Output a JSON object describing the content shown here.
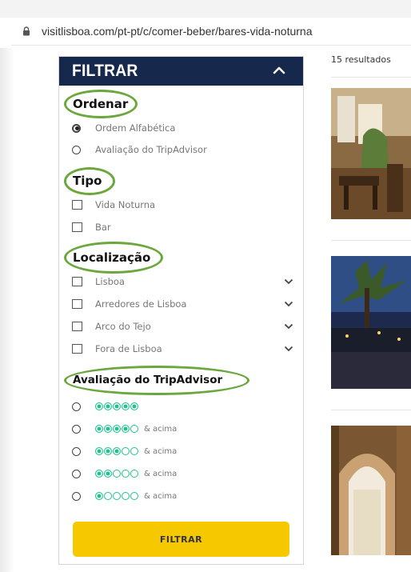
{
  "browser": {
    "url": "visitlisboa.com/pt-pt/c/comer-beber/bares-vida-noturna"
  },
  "filter_panel": {
    "title": "FILTRAR",
    "sort": {
      "title": "Ordenar",
      "options": [
        {
          "label": "Ordem Alfabética",
          "checked": true
        },
        {
          "label": "Avaliação do TripAdvisor",
          "checked": false
        }
      ]
    },
    "type": {
      "title": "Tipo",
      "options": [
        {
          "label": "Vida Noturna",
          "checked": false
        },
        {
          "label": "Bar",
          "checked": false
        }
      ]
    },
    "location": {
      "title": "Localização",
      "options": [
        {
          "label": "Lisboa",
          "checked": false
        },
        {
          "label": "Arredores de Lisboa",
          "checked": false
        },
        {
          "label": "Arco do Tejo",
          "checked": false
        },
        {
          "label": "Fora de Lisboa",
          "checked": false
        }
      ]
    },
    "rating": {
      "title": "Avaliação do TripAdvisor",
      "suffix": "& acima",
      "options": [
        {
          "rating": 5,
          "suffix": ""
        },
        {
          "rating": 4,
          "suffix": "& acima"
        },
        {
          "rating": 3,
          "suffix": "& acima"
        },
        {
          "rating": 2,
          "suffix": "& acima"
        },
        {
          "rating": 1,
          "suffix": "& acima"
        }
      ]
    },
    "button_label": "FILTRAR"
  },
  "results": {
    "count_label": "15 resultados"
  },
  "colors": {
    "header_bg": "#16294d",
    "button_bg": "#f5c800",
    "highlight_ring": "#6aa73c",
    "tripadvisor_green": "#1fc18e"
  }
}
